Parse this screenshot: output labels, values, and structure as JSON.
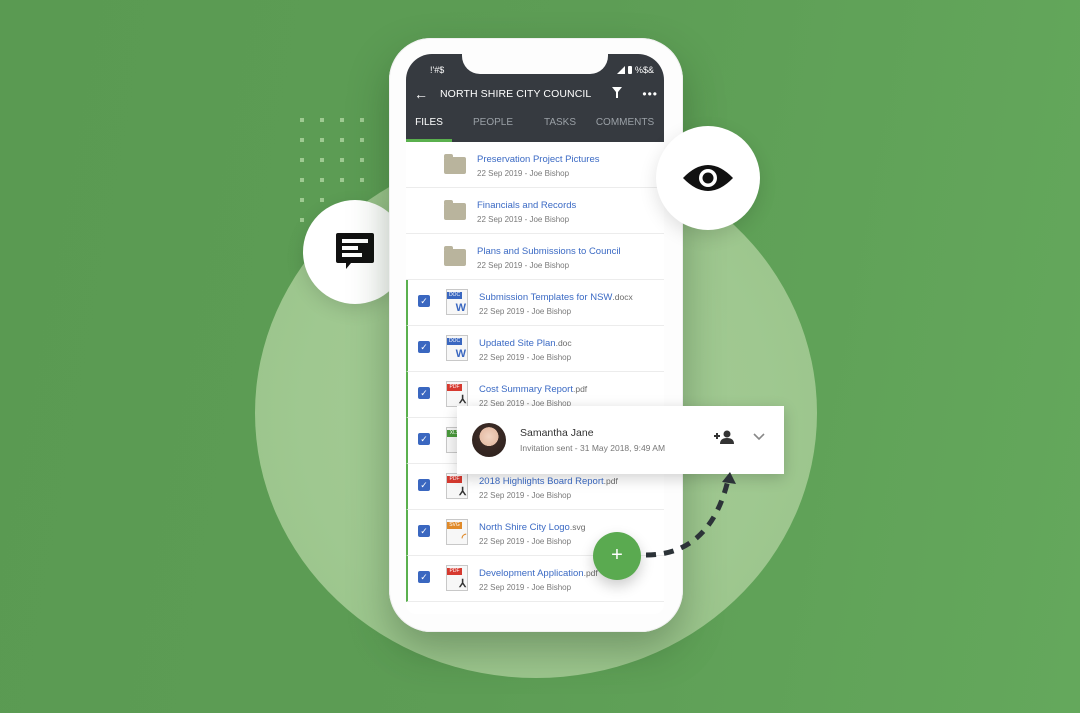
{
  "status_bar": {
    "left": "!'#$",
    "right": "%$&"
  },
  "header": {
    "title": "NORTH SHIRE CITY COUNCIL",
    "back_icon": "arrow-left-icon",
    "filter_icon": "filter-icon",
    "more_icon": "more-horizontal-icon"
  },
  "tabs": [
    {
      "label": "FILES",
      "active": true
    },
    {
      "label": "PEOPLE",
      "active": false
    },
    {
      "label": "TASKS",
      "active": false
    },
    {
      "label": "COMMENTS",
      "active": false
    }
  ],
  "files": [
    {
      "name": "Preservation Project Pictures",
      "ext": "",
      "meta": "22 Sep 2019 - Joe Bishop",
      "type": "folder",
      "selected": false
    },
    {
      "name": "Financials and Records",
      "ext": "",
      "meta": "22 Sep 2019 - Joe Bishop",
      "type": "folder",
      "selected": false
    },
    {
      "name": "Plans and Submissions to Council",
      "ext": "",
      "meta": "22 Sep 2019 - Joe Bishop",
      "type": "folder",
      "selected": false
    },
    {
      "name": "Submission Templates for NSW",
      "ext": ".docx",
      "meta": "22 Sep 2019 - Joe Bishop",
      "type": "doc",
      "badge": "DOC",
      "selected": true
    },
    {
      "name": "Updated Site Plan",
      "ext": ".doc",
      "meta": "22 Sep 2019 - Joe Bishop",
      "type": "doc",
      "badge": "DOC",
      "selected": true
    },
    {
      "name": "Cost Summary Report",
      "ext": ".pdf",
      "meta": "22 Sep 2019 - Joe Bishop",
      "type": "pdf",
      "badge": "PDF",
      "selected": true
    },
    {
      "name": "",
      "ext": "",
      "meta": "",
      "type": "xls",
      "badge": "XLS",
      "selected": true
    },
    {
      "name": "2018 Highlights Board Report",
      "ext": ".pdf",
      "meta": "22 Sep 2019 - Joe Bishop",
      "type": "pdf",
      "badge": "PDF",
      "selected": true
    },
    {
      "name": "North Shire City Logo",
      "ext": ".svg",
      "meta": "22 Sep 2019 - Joe Bishop",
      "type": "svg",
      "badge": "SVG",
      "selected": true
    },
    {
      "name": "Development Application",
      "ext": ".pdf",
      "meta": "22 Sep 2019 - Joe Bishop",
      "type": "pdf",
      "badge": "PDF",
      "selected": true
    }
  ],
  "invite_card": {
    "name": "Samantha Jane",
    "subtitle": "Invitation sent - 31 May 2018, 9:49 AM",
    "add_icon": "person-add-icon",
    "expand_icon": "chevron-down-icon"
  },
  "fab": {
    "label": "+"
  },
  "floating_icons": {
    "comment": "comment-icon",
    "view": "eye-icon"
  },
  "colors": {
    "background": "#5d9d55",
    "accent": "#5ab04e",
    "appbar": "#363a40",
    "link": "#3b6ac4",
    "checkbox": "#3a67c0"
  }
}
